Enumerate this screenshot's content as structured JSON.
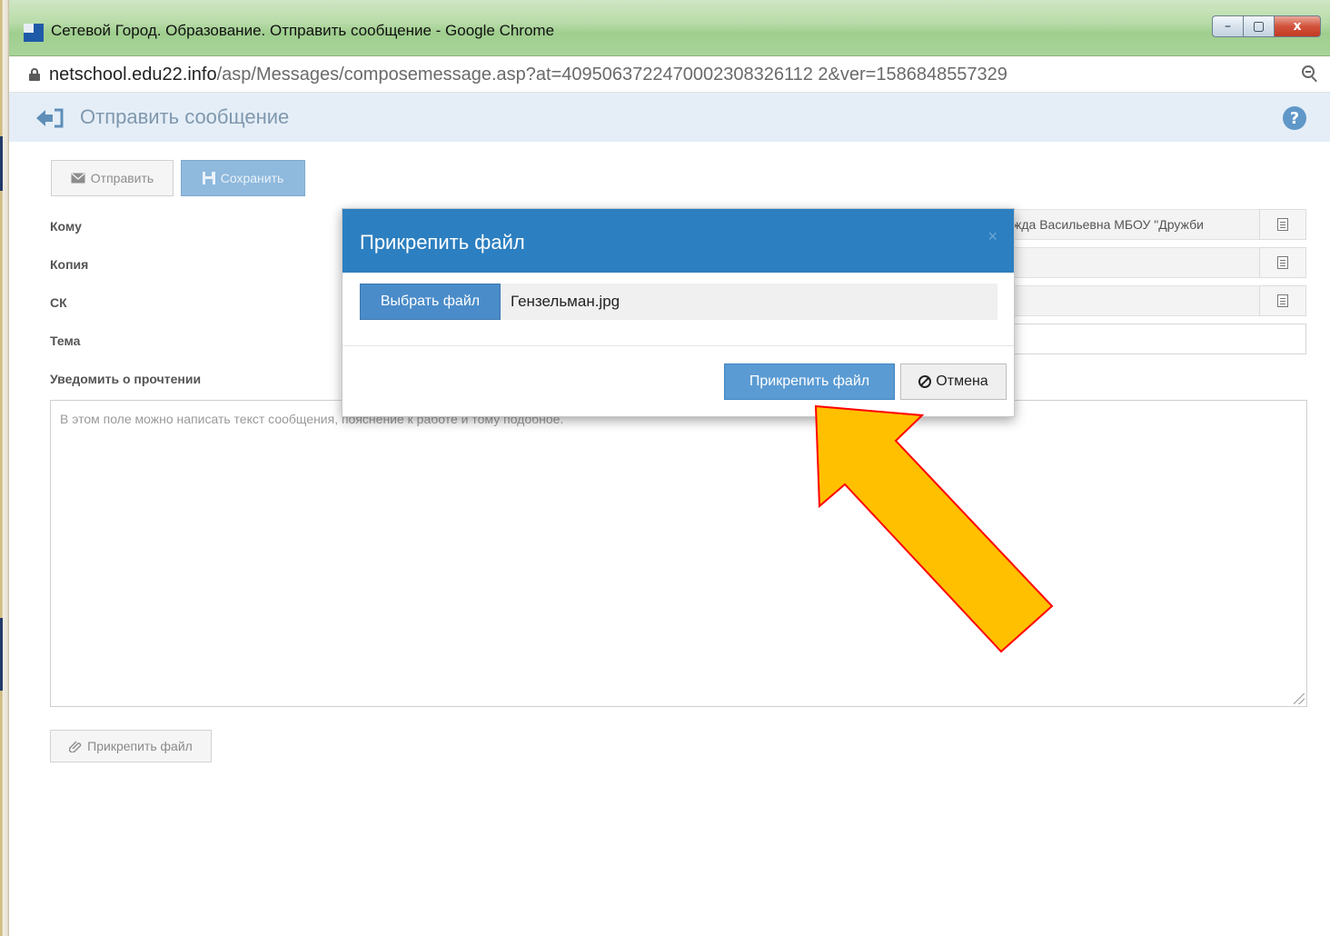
{
  "window": {
    "title": "Сетевой Город. Образование. Отправить сообщение - Google Chrome",
    "minimize": "–",
    "maximize": "▢",
    "close": "x"
  },
  "address": {
    "host": "netschool.edu22.info",
    "path": "/asp/Messages/composemessage.asp?at=4095063722470002308326112 2&ver=1586848557329"
  },
  "page": {
    "title": "Отправить сообщение",
    "help": "?"
  },
  "toolbar": {
    "send_label": "Отправить",
    "save_label": "Сохранить"
  },
  "form": {
    "to_label": "Кому",
    "to_value": "жда Васильевна МБОУ \"Дружби",
    "cc_label": "Копия",
    "bcc_label": "СК",
    "subject_label": "Тема",
    "notify_label": "Уведомить о прочтении",
    "message_placeholder": "В этом поле можно написать текст сообщения, пояснение к работе и тому подобное.",
    "attach_label": "Прикрепить файл"
  },
  "modal": {
    "title": "Прикрепить файл",
    "close": "×",
    "choose_label": "Выбрать файл",
    "file_name": "Гензельман.jpg",
    "attach_label": "Прикрепить файл",
    "cancel_label": "Отмена"
  },
  "colors": {
    "modal_header": "#2c7fc0",
    "primary_button": "#5a9bd3",
    "arrow_fill": "#ffc000",
    "arrow_stroke": "#ff0000"
  }
}
